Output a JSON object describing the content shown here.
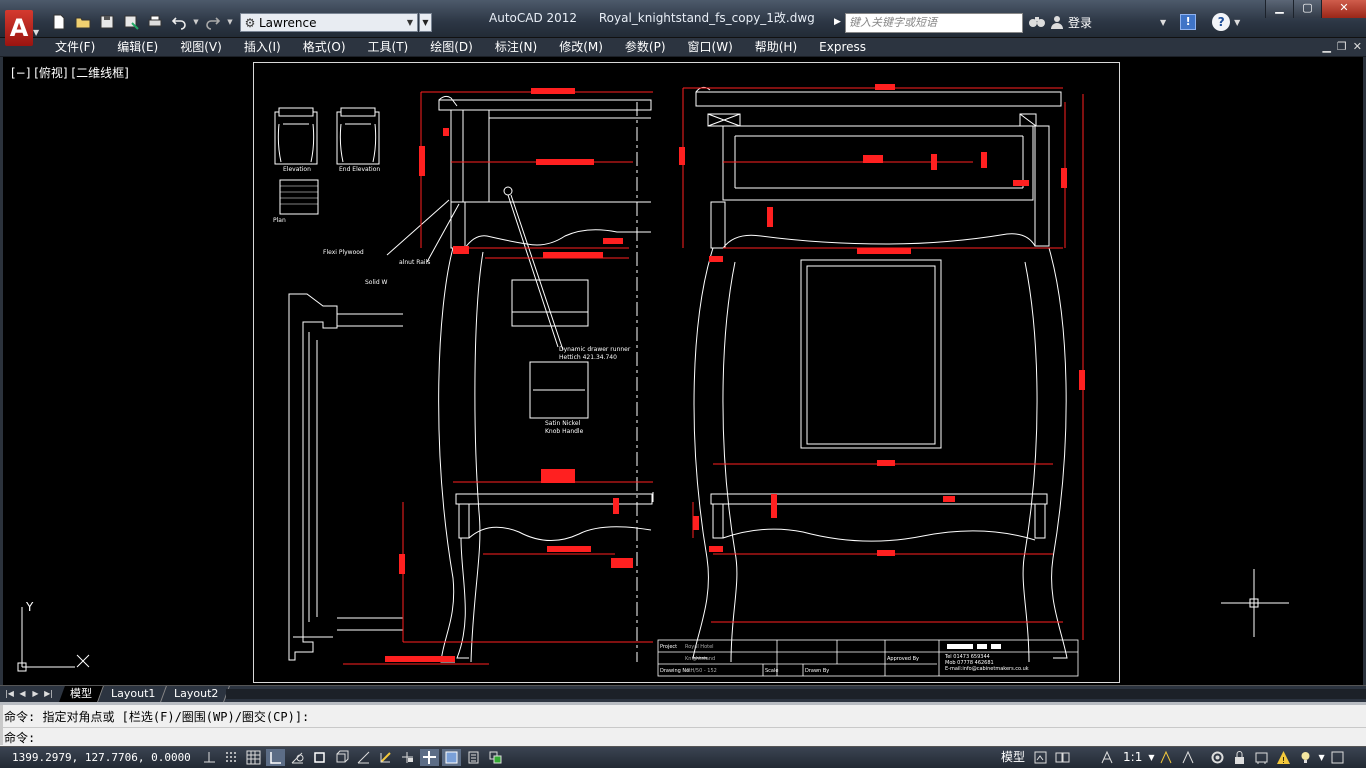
{
  "title_bar": {
    "app_name": "AutoCAD 2012",
    "file_name": "Royal_knightstand_fs_copy_1改.dwg",
    "workspace": "Lawrence",
    "search_placeholder": "键入关键字或短语",
    "login_label": "登录",
    "exchange_label": "!",
    "help_label": "?"
  },
  "menu": [
    "文件(F)",
    "编辑(E)",
    "视图(V)",
    "插入(I)",
    "格式(O)",
    "工具(T)",
    "绘图(D)",
    "标注(N)",
    "修改(M)",
    "参数(P)",
    "窗口(W)",
    "帮助(H)",
    "Express"
  ],
  "viewport": {
    "label": "[−] [俯视] [二维线框]"
  },
  "drawing": {
    "labels": {
      "elevation": "Elevation",
      "end_elevation": "End Elevation",
      "plan": "Plan",
      "flexi_plywood": "Flexi Plywood",
      "walnut_rails": "alnut Rails",
      "solid_w": "Solid W",
      "drawer_runner_1": "Dynamic drawer runner",
      "drawer_runner_2": "Hettich 421.34.740",
      "knob_1": "Satin Nickel",
      "knob_2": "Knob Handle"
    },
    "title_block": {
      "project_label": "Project",
      "project_value": "Royal Hotel",
      "client_label": "",
      "title_value": "Knightstand",
      "drawing_no_label": "Drawing No:",
      "drawing_no_value": "RH/50 - 152",
      "scale_label": "Scale",
      "drawn_by_label": "Drawn By",
      "approved_label": "Approved By",
      "phone": "Tel  01473 659344",
      "mobile": "Mob  07778 462681",
      "email": "E-mail:info@cabinetmakers.co.uk"
    }
  },
  "ucs": {
    "y_label": "Y",
    "x_label": "X"
  },
  "layout_tabs": [
    {
      "label": "模型",
      "active": true
    },
    {
      "label": "Layout1",
      "active": false
    },
    {
      "label": "Layout2",
      "active": false
    }
  ],
  "command_line": {
    "history": "命令: 指定对角点或 [栏选(F)/圈围(WP)/圈交(CP)]:",
    "prompt": "命令:"
  },
  "status_bar": {
    "coordinates": "1399.2979, 127.7706, 0.0000",
    "model_label": "模型",
    "annotation_scale": "1:1"
  },
  "colors": {
    "dimension": "#ff0000",
    "geometry": "#ffffff",
    "background": "#000000",
    "chrome": "#2c3440"
  }
}
